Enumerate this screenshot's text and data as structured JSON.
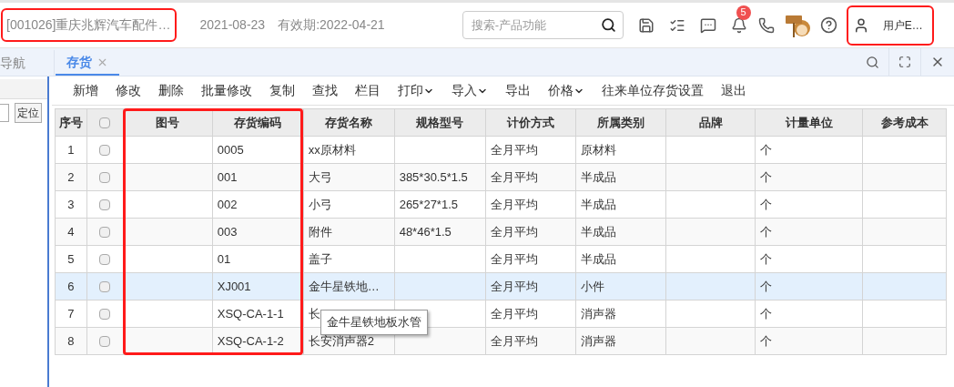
{
  "header": {
    "company": {
      "text": "[001026]重庆兆辉汽车配件…",
      "highlighted": true
    },
    "date": "2021-08-23",
    "validity": "有效期:2022-04-21",
    "search": {
      "placeholder": "搜索-产品功能"
    },
    "notification_count": "5",
    "user": {
      "text": "用户E…",
      "highlighted": true
    }
  },
  "tabs": [
    {
      "label": "导航",
      "selected": false
    },
    {
      "label": "存货",
      "selected": true,
      "closable": true
    }
  ],
  "left_panel": {
    "locate_button": "定位"
  },
  "toolbar": [
    {
      "label": "新增"
    },
    {
      "label": "修改"
    },
    {
      "label": "删除"
    },
    {
      "label": "批量修改"
    },
    {
      "label": "复制"
    },
    {
      "label": "查找"
    },
    {
      "label": "栏目"
    },
    {
      "label": "打印",
      "dropdown": true
    },
    {
      "label": "导入",
      "dropdown": true
    },
    {
      "label": "导出"
    },
    {
      "label": "价格",
      "dropdown": true
    },
    {
      "label": "往来单位存货设置"
    },
    {
      "label": "退出"
    }
  ],
  "table": {
    "columns": [
      {
        "label": "序号"
      },
      {
        "kind": "checkbox",
        "checked": false
      },
      {
        "label": "图号",
        "highlighted": true
      },
      {
        "label": "存货编码",
        "highlighted": true
      },
      {
        "label": "存货名称"
      },
      {
        "label": "规格型号"
      },
      {
        "label": "计价方式"
      },
      {
        "label": "所属类别"
      },
      {
        "label": "品牌"
      },
      {
        "label": "计量单位"
      },
      {
        "label": "参考成本"
      }
    ],
    "rows": [
      {
        "selected": false,
        "checked": false,
        "cells": [
          "1",
          "",
          "",
          "0005",
          "xx原材料",
          "",
          "全月平均",
          "原材料",
          "",
          "个",
          ""
        ]
      },
      {
        "selected": false,
        "checked": false,
        "cells": [
          "2",
          "",
          "",
          "001",
          "大弓",
          "385*30.5*1.5",
          "全月平均",
          "半成品",
          "",
          "个",
          ""
        ]
      },
      {
        "selected": false,
        "checked": false,
        "cells": [
          "3",
          "",
          "",
          "002",
          "小弓",
          "265*27*1.5",
          "全月平均",
          "半成品",
          "",
          "个",
          ""
        ]
      },
      {
        "selected": false,
        "checked": false,
        "cells": [
          "4",
          "",
          "",
          "003",
          "附件",
          "48*46*1.5",
          "全月平均",
          "半成品",
          "",
          "个",
          ""
        ]
      },
      {
        "selected": false,
        "checked": false,
        "cells": [
          "5",
          "",
          "",
          "01",
          "盖子",
          "",
          "全月平均",
          "半成品",
          "",
          "个",
          ""
        ]
      },
      {
        "selected": true,
        "checked": false,
        "cells": [
          "6",
          "",
          "",
          "XJ001",
          "金牛星铁地…",
          "",
          "全月平均",
          "小件",
          "",
          "个",
          ""
        ]
      },
      {
        "selected": false,
        "checked": false,
        "cells": [
          "7",
          "",
          "",
          "XSQ-CA-1-1",
          "长",
          "",
          "全月平均",
          "消声器",
          "",
          "个",
          ""
        ]
      },
      {
        "selected": false,
        "checked": false,
        "cells": [
          "8",
          "",
          "",
          "XSQ-CA-1-2",
          "长安消声器2",
          "",
          "全月平均",
          "消声器",
          "",
          "个",
          ""
        ]
      }
    ],
    "tooltip": "金牛星铁地板水管"
  }
}
